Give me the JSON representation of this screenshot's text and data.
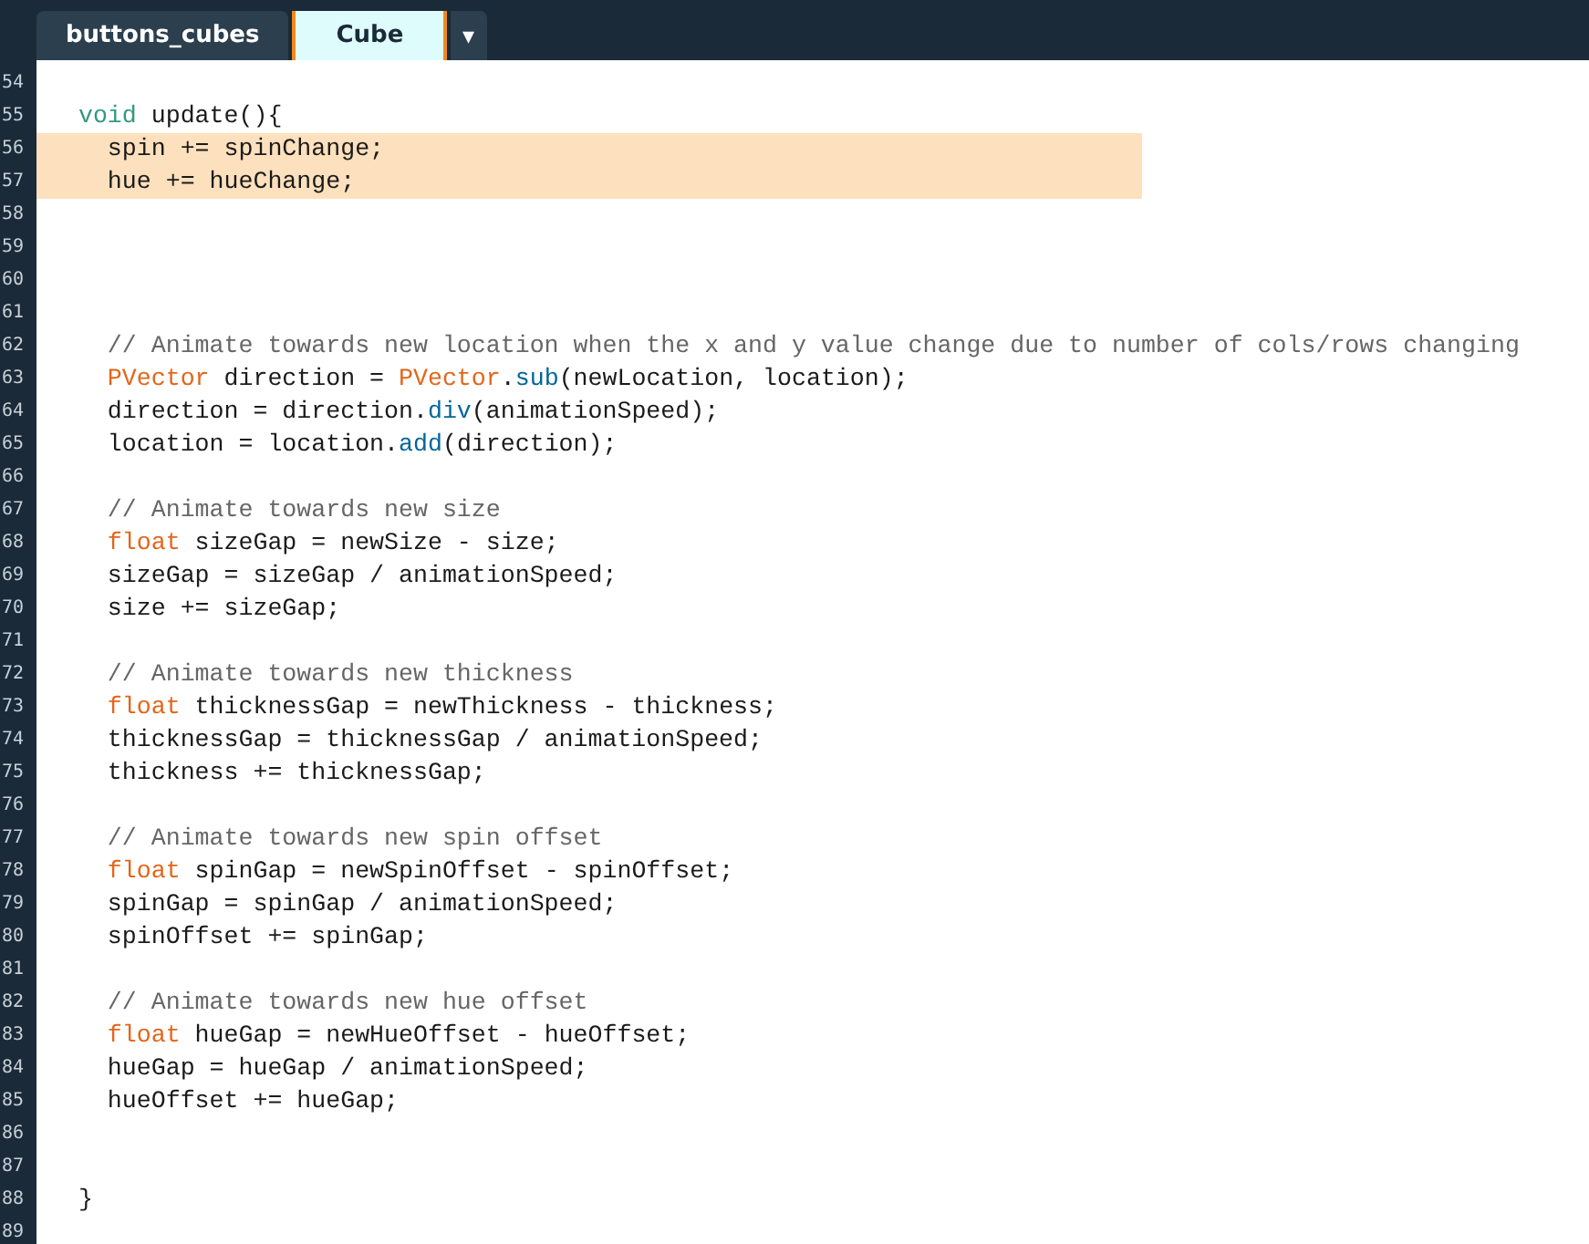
{
  "tabs": [
    {
      "label": "buttons_cubes",
      "selected": false
    },
    {
      "label": "Cube",
      "selected": true
    }
  ],
  "tab_menu": {
    "label": "▾"
  },
  "editor": {
    "lines": [
      {
        "number": "54",
        "highlighted": false
      },
      {
        "number": "55",
        "highlighted": false,
        "tokens": [
          {
            "kind": "keyword",
            "text": "  void"
          },
          {
            "kind": "plain",
            "text": " update(){"
          }
        ]
      },
      {
        "number": "56",
        "highlighted": true,
        "tokens": [
          {
            "kind": "plain",
            "text": "    spin += spinChange;"
          }
        ]
      },
      {
        "number": "57",
        "highlighted": true,
        "tokens": [
          {
            "kind": "plain",
            "text": "    hue += hueChange;"
          }
        ]
      },
      {
        "number": "58",
        "highlighted": false
      },
      {
        "number": "59",
        "highlighted": false
      },
      {
        "number": "60",
        "highlighted": false
      },
      {
        "number": "61",
        "highlighted": false
      },
      {
        "number": "62",
        "highlighted": false,
        "tokens": [
          {
            "kind": "comment",
            "text": "    // Animate towards new location when the x and y value change due to number of cols/rows changing"
          }
        ]
      },
      {
        "number": "63",
        "highlighted": false,
        "tokens": [
          {
            "kind": "type",
            "text": "    PVector"
          },
          {
            "kind": "plain",
            "text": " direction = "
          },
          {
            "kind": "type",
            "text": "PVector"
          },
          {
            "kind": "plain",
            "text": "."
          },
          {
            "kind": "method",
            "text": "sub"
          },
          {
            "kind": "plain",
            "text": "(newLocation, location);"
          }
        ]
      },
      {
        "number": "64",
        "highlighted": false,
        "tokens": [
          {
            "kind": "plain",
            "text": "    direction = direction."
          },
          {
            "kind": "method",
            "text": "div"
          },
          {
            "kind": "plain",
            "text": "(animationSpeed);"
          }
        ]
      },
      {
        "number": "65",
        "highlighted": false,
        "tokens": [
          {
            "kind": "plain",
            "text": "    location = location."
          },
          {
            "kind": "method",
            "text": "add"
          },
          {
            "kind": "plain",
            "text": "(direction);"
          }
        ]
      },
      {
        "number": "66",
        "highlighted": false
      },
      {
        "number": "67",
        "highlighted": false,
        "tokens": [
          {
            "kind": "comment",
            "text": "    // Animate towards new size"
          }
        ]
      },
      {
        "number": "68",
        "highlighted": false,
        "tokens": [
          {
            "kind": "type",
            "text": "    float"
          },
          {
            "kind": "plain",
            "text": " sizeGap = newSize - size;"
          }
        ]
      },
      {
        "number": "69",
        "highlighted": false,
        "tokens": [
          {
            "kind": "plain",
            "text": "    sizeGap = sizeGap / animationSpeed;"
          }
        ]
      },
      {
        "number": "70",
        "highlighted": false,
        "tokens": [
          {
            "kind": "plain",
            "text": "    size += sizeGap;"
          }
        ]
      },
      {
        "number": "71",
        "highlighted": false
      },
      {
        "number": "72",
        "highlighted": false,
        "tokens": [
          {
            "kind": "comment",
            "text": "    // Animate towards new thickness"
          }
        ]
      },
      {
        "number": "73",
        "highlighted": false,
        "tokens": [
          {
            "kind": "type",
            "text": "    float"
          },
          {
            "kind": "plain",
            "text": " thicknessGap = newThickness - thickness;"
          }
        ]
      },
      {
        "number": "74",
        "highlighted": false,
        "tokens": [
          {
            "kind": "plain",
            "text": "    thicknessGap = thicknessGap / animationSpeed;"
          }
        ]
      },
      {
        "number": "75",
        "highlighted": false,
        "tokens": [
          {
            "kind": "plain",
            "text": "    thickness += thicknessGap;"
          }
        ]
      },
      {
        "number": "76",
        "highlighted": false
      },
      {
        "number": "77",
        "highlighted": false,
        "tokens": [
          {
            "kind": "comment",
            "text": "    // Animate towards new spin offset"
          }
        ]
      },
      {
        "number": "78",
        "highlighted": false,
        "tokens": [
          {
            "kind": "type",
            "text": "    float"
          },
          {
            "kind": "plain",
            "text": " spinGap = newSpinOffset - spinOffset;"
          }
        ]
      },
      {
        "number": "79",
        "highlighted": false,
        "tokens": [
          {
            "kind": "plain",
            "text": "    spinGap = spinGap / animationSpeed;"
          }
        ]
      },
      {
        "number": "80",
        "highlighted": false,
        "tokens": [
          {
            "kind": "plain",
            "text": "    spinOffset += spinGap;"
          }
        ]
      },
      {
        "number": "81",
        "highlighted": false
      },
      {
        "number": "82",
        "highlighted": false,
        "tokens": [
          {
            "kind": "comment",
            "text": "    // Animate towards new hue offset"
          }
        ]
      },
      {
        "number": "83",
        "highlighted": false,
        "tokens": [
          {
            "kind": "type",
            "text": "    float"
          },
          {
            "kind": "plain",
            "text": " hueGap = newHueOffset - hueOffset;"
          }
        ]
      },
      {
        "number": "84",
        "highlighted": false,
        "tokens": [
          {
            "kind": "plain",
            "text": "    hueGap = hueGap / animationSpeed;"
          }
        ]
      },
      {
        "number": "85",
        "highlighted": false,
        "tokens": [
          {
            "kind": "plain",
            "text": "    hueOffset += hueGap;"
          }
        ]
      },
      {
        "number": "86",
        "highlighted": false
      },
      {
        "number": "87",
        "highlighted": false
      },
      {
        "number": "88",
        "highlighted": false,
        "tokens": [
          {
            "kind": "plain",
            "text": "  }"
          }
        ]
      },
      {
        "number": "89",
        "highlighted": false
      }
    ]
  }
}
